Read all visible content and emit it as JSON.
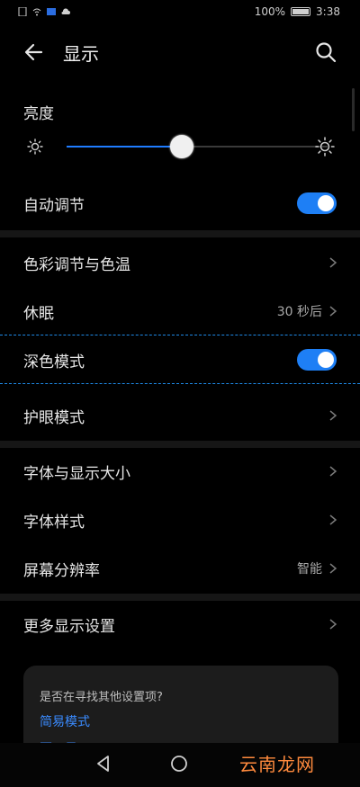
{
  "status_bar": {
    "battery": "100%",
    "time": "3:38"
  },
  "header": {
    "title": "显示"
  },
  "brightness": {
    "label": "亮度",
    "level_percent": 44
  },
  "rows": {
    "auto": {
      "label": "自动调节",
      "toggle_on": true
    },
    "color": {
      "label": "色彩调节与色温"
    },
    "sleep": {
      "label": "休眠",
      "value": "30 秒后"
    },
    "dark": {
      "label": "深色模式",
      "toggle_on": true
    },
    "eye": {
      "label": "护眼模式"
    },
    "font_size": {
      "label": "字体与显示大小"
    },
    "font_style": {
      "label": "字体样式"
    },
    "resolution": {
      "label": "屏幕分辨率",
      "value": "智能"
    },
    "more": {
      "label": "更多显示设置"
    }
  },
  "suggestion_card": {
    "question": "是否在寻找其他设置项?",
    "link1": "简易模式",
    "link2": "页面显示"
  },
  "watermark": "云南龙网",
  "colors": {
    "accent": "#1e7ff5",
    "background": "#000000"
  }
}
